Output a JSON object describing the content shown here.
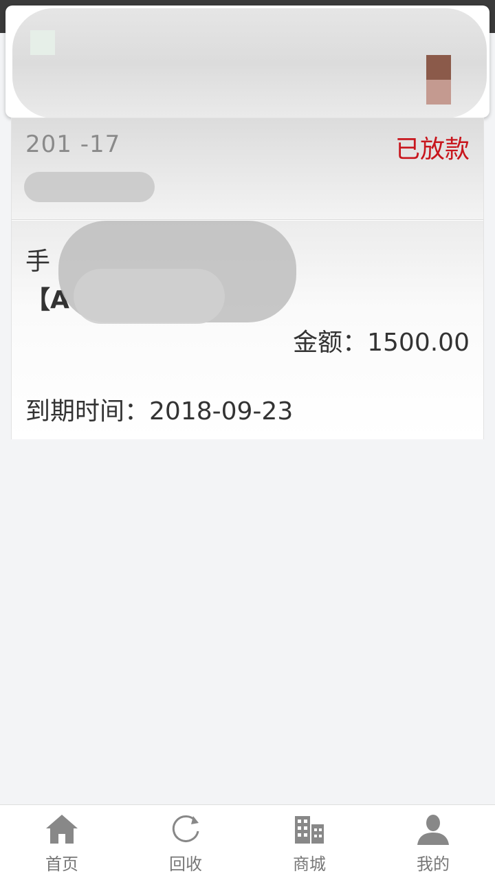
{
  "order": {
    "date": "201  -17",
    "status": "已放款",
    "product_line_1": "手",
    "product_line_2": "【A",
    "amount_label": "金额：",
    "amount_value": "1500.00",
    "due_label": "到期时间：",
    "due_value": "2018-09-23"
  },
  "tabbar": {
    "items": [
      {
        "label": "首页",
        "icon": "home-icon"
      },
      {
        "label": "回收",
        "icon": "refresh-icon"
      },
      {
        "label": "商城",
        "icon": "building-icon"
      },
      {
        "label": "我的",
        "icon": "user-icon"
      }
    ]
  },
  "colors": {
    "status": "#c8161d",
    "icon": "#888888",
    "background": "#f3f4f6"
  }
}
